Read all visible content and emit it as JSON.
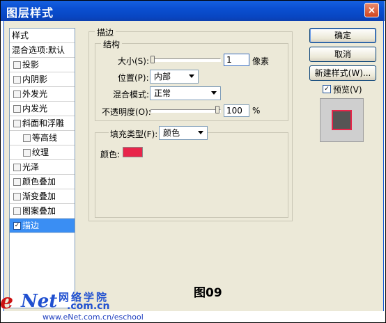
{
  "window": {
    "title": "图层样式",
    "close_glyph": "×"
  },
  "sidebar": {
    "header": "样式",
    "blend": "混合选项:默认",
    "items": [
      {
        "label": "投影",
        "checked": false,
        "sub": false
      },
      {
        "label": "内阴影",
        "checked": false,
        "sub": false
      },
      {
        "label": "外发光",
        "checked": false,
        "sub": false
      },
      {
        "label": "内发光",
        "checked": false,
        "sub": false
      },
      {
        "label": "斜面和浮雕",
        "checked": false,
        "sub": false
      },
      {
        "label": "等高线",
        "checked": false,
        "sub": true
      },
      {
        "label": "纹理",
        "checked": false,
        "sub": true
      },
      {
        "label": "光泽",
        "checked": false,
        "sub": false
      },
      {
        "label": "颜色叠加",
        "checked": false,
        "sub": false
      },
      {
        "label": "渐变叠加",
        "checked": false,
        "sub": false
      },
      {
        "label": "图案叠加",
        "checked": false,
        "sub": false
      },
      {
        "label": "描边",
        "checked": true,
        "sub": false
      }
    ]
  },
  "stroke": {
    "group_title": "描边",
    "structure_title": "结构",
    "size_label": "大小(S):",
    "size_value": "1",
    "size_unit": "像素",
    "size_slider_fraction": 0.0,
    "position_label": "位置(P):",
    "position_value": "内部",
    "blend_label": "混合模式:",
    "blend_value": "正常",
    "opacity_label": "不透明度(O):",
    "opacity_value": "100",
    "opacity_unit": "%",
    "opacity_slider_fraction": 1.0,
    "fill_type_label": "填充类型(F):",
    "fill_type_value": "颜色",
    "color_label": "颜色:",
    "color": "#e8254a"
  },
  "buttons": {
    "ok": "确定",
    "cancel": "取消",
    "new_style": "新建样式(W)...",
    "preview_label": "预览(V)",
    "preview_checked": true
  },
  "overlay": {
    "figure_label": "图09",
    "logo_e": "e",
    "logo_net": "Net",
    "logo_cn": "网络学院",
    "logo_com": ".com.cn",
    "url": "www.eNet.com.cn/eschool"
  }
}
